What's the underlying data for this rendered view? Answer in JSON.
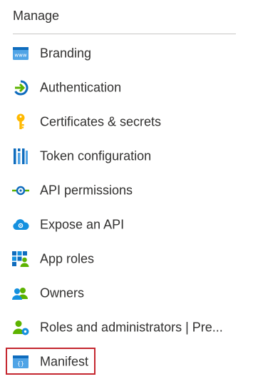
{
  "section": {
    "title": "Manage"
  },
  "nav": {
    "items": [
      {
        "label": "Branding",
        "icon": "branding-icon"
      },
      {
        "label": "Authentication",
        "icon": "authentication-icon"
      },
      {
        "label": "Certificates & secrets",
        "icon": "key-icon"
      },
      {
        "label": "Token configuration",
        "icon": "token-configuration-icon"
      },
      {
        "label": "API permissions",
        "icon": "api-permissions-icon"
      },
      {
        "label": "Expose an API",
        "icon": "cloud-icon"
      },
      {
        "label": "App roles",
        "icon": "app-roles-icon"
      },
      {
        "label": "Owners",
        "icon": "owners-icon"
      },
      {
        "label": "Roles and administrators | Pre...",
        "icon": "roles-administrators-icon"
      },
      {
        "label": "Manifest",
        "icon": "manifest-icon",
        "highlighted": true
      }
    ]
  },
  "colors": {
    "text": "#323130",
    "divider": "#c8c6c4",
    "highlight_border": "#c4262e",
    "accent_blue": "#0078d4",
    "accent_green": "#5db300",
    "key_yellow": "#ffb900"
  }
}
